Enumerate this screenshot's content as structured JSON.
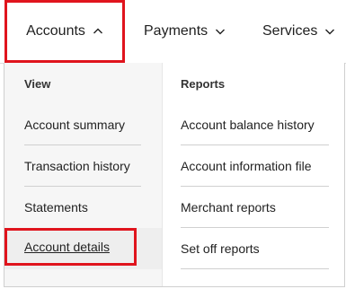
{
  "topnav": {
    "items": [
      {
        "label": "Accounts",
        "icon": "chevron-up-icon",
        "state": "open"
      },
      {
        "label": "Payments",
        "icon": "chevron-down-icon"
      },
      {
        "label": "Services",
        "icon": "chevron-down-icon"
      }
    ]
  },
  "dropdown": {
    "view": {
      "heading": "View",
      "items": [
        {
          "label": "Account summary"
        },
        {
          "label": "Transaction history"
        },
        {
          "label": "Statements"
        },
        {
          "label": "Account details"
        }
      ]
    },
    "reports": {
      "heading": "Reports",
      "items": [
        {
          "label": "Account balance history"
        },
        {
          "label": "Account information file"
        },
        {
          "label": "Merchant reports"
        },
        {
          "label": "Set off reports"
        }
      ]
    }
  },
  "colors": {
    "highlight_border": "#e0141d",
    "text": "#222222",
    "view_column_bg": "#f6f6f6"
  }
}
